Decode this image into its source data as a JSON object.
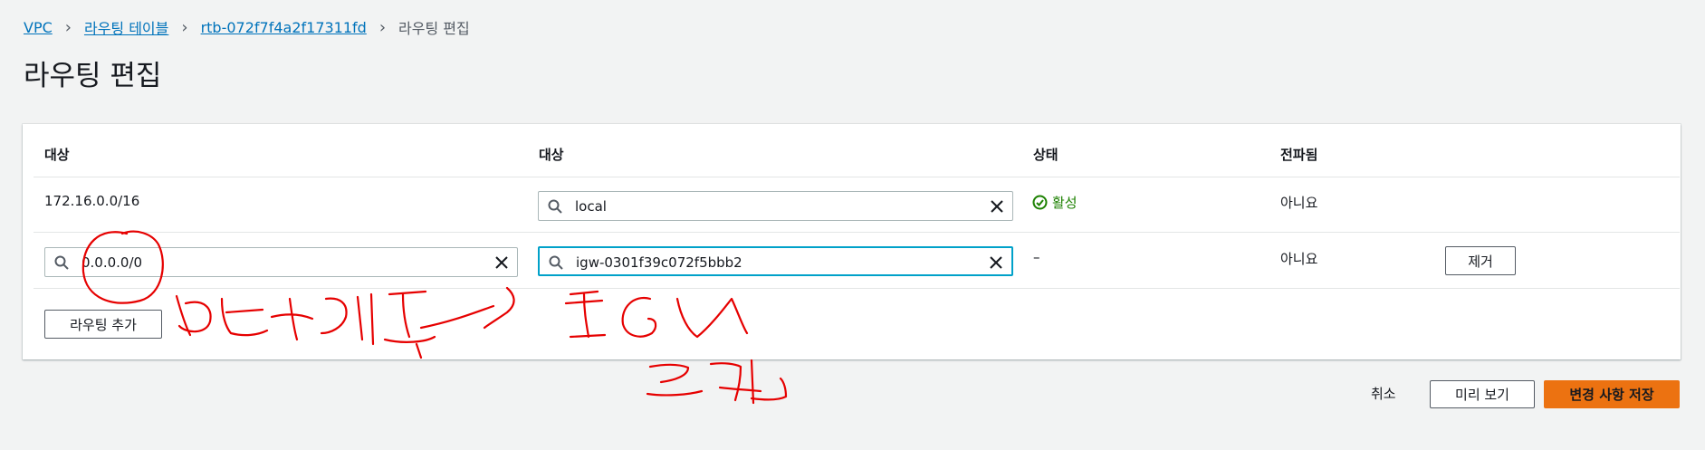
{
  "breadcrumb": {
    "items": [
      "VPC",
      "라우팅 테이블",
      "rtb-072f7f4a2f17311fd"
    ],
    "current": "라우팅 편집"
  },
  "page": {
    "title": "라우팅 편집"
  },
  "table": {
    "headers": [
      "대상",
      "대상",
      "상태",
      "전파됨"
    ],
    "rows": [
      {
        "destination": "172.16.0.0/16",
        "target": "local",
        "status": "활성",
        "propagated": "아니요"
      },
      {
        "destination": "0.0.0.0/0",
        "target": "igw-0301f39c072f5bbb2",
        "status": "–",
        "propagated": "아니요",
        "remove_label": "제거"
      }
    ],
    "add_route_label": "라우팅 추가"
  },
  "footer": {
    "cancel_label": "취소",
    "preview_label": "미리 보기",
    "save_label": "변경 사항 저장"
  },
  "colors": {
    "link": "#0073bb",
    "primary_button": "#ec7211",
    "status_active": "#1d8102",
    "focus_border": "#00a1c9",
    "annotation": "#e60000"
  }
}
